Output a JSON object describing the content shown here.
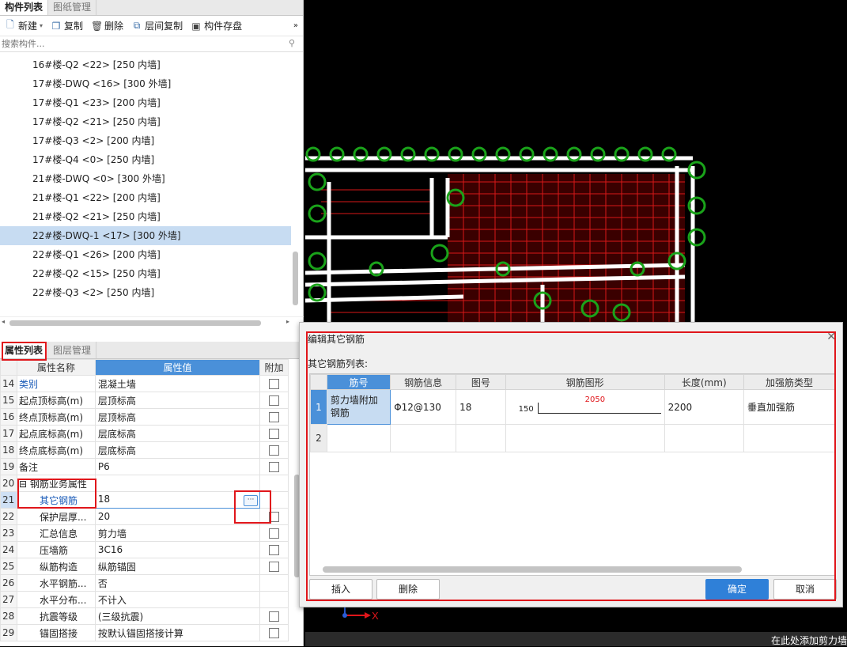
{
  "top_panel": {
    "tabs": [
      "构件列表",
      "图纸管理"
    ],
    "toolbar": {
      "new": "新建",
      "copy": "复制",
      "delete": "删除",
      "floor_copy": "层间复制",
      "save": "构件存盘",
      "more": "»"
    },
    "search_placeholder": "搜索构件...",
    "items": [
      "16#楼-Q2 <22> [250 内墙]",
      "17#楼-DWQ <16> [300 外墙]",
      "17#楼-Q1 <23> [200 内墙]",
      "17#楼-Q2 <21> [250 内墙]",
      "17#楼-Q3 <2> [200 内墙]",
      "17#楼-Q4 <0> [250 内墙]",
      "21#楼-DWQ <0> [300 外墙]",
      "21#楼-Q1 <22> [200 内墙]",
      "21#楼-Q2 <21> [250 内墙]",
      "22#楼-DWQ-1 <17> [300 外墙]",
      "22#楼-Q1 <26> [200 内墙]",
      "22#楼-Q2 <15> [250 内墙]",
      "22#楼-Q3 <2> [250 内墙]"
    ],
    "selected_index": 9
  },
  "prop_panel": {
    "tabs": [
      "属性列表",
      "图层管理"
    ],
    "headers": [
      "属性名称",
      "属性值",
      "附加"
    ],
    "rows": [
      {
        "num": "14",
        "name": "类别",
        "value": "混凝土墙",
        "check": true,
        "blue": true
      },
      {
        "num": "15",
        "name": "起点顶标高(m)",
        "value": "层顶标高",
        "check": true
      },
      {
        "num": "16",
        "name": "终点顶标高(m)",
        "value": "层顶标高",
        "check": true
      },
      {
        "num": "17",
        "name": "起点底标高(m)",
        "value": "层底标高",
        "check": true
      },
      {
        "num": "18",
        "name": "终点底标高(m)",
        "value": "层底标高",
        "check": true
      },
      {
        "num": "19",
        "name": "备注",
        "value": "P6",
        "check": true
      },
      {
        "num": "20",
        "name": "⊟ 钢筋业务属性",
        "value": "",
        "check": false
      },
      {
        "num": "21",
        "name": "其它钢筋",
        "value": "18",
        "check": false,
        "blue": true,
        "selected": true
      },
      {
        "num": "22",
        "name": "保护层厚...",
        "value": "20",
        "check": true
      },
      {
        "num": "23",
        "name": "汇总信息",
        "value": "剪力墙",
        "check": true
      },
      {
        "num": "24",
        "name": "压墙筋",
        "value": "3C16",
        "check": true
      },
      {
        "num": "25",
        "name": "纵筋构造",
        "value": "纵筋锚固",
        "check": true
      },
      {
        "num": "26",
        "name": "水平钢筋...",
        "value": "否",
        "check": false
      },
      {
        "num": "27",
        "name": "水平分布...",
        "value": "不计入",
        "check": false
      },
      {
        "num": "28",
        "name": "抗震等级",
        "value": "(三级抗震)",
        "check": true
      },
      {
        "num": "29",
        "name": "锚固搭接",
        "value": "按默认锚固搭接计算",
        "check": true
      }
    ]
  },
  "dialog": {
    "title": "编辑其它钢筋",
    "subtitle": "其它钢筋列表:",
    "headers": [
      "筋号",
      "钢筋信息",
      "图号",
      "钢筋图形",
      "长度(mm)",
      "加强筋类型"
    ],
    "row1": {
      "num": "1",
      "bar_no": "剪力墙附加钢筋",
      "bar_info": "Φ12@130",
      "fig_no": "18",
      "shape_left": "150",
      "shape_len": "2050",
      "length": "2200",
      "type": "垂直加强筋"
    },
    "row2_num": "2",
    "buttons": {
      "insert": "插入",
      "delete": "删除",
      "ok": "确定",
      "cancel": "取消"
    }
  },
  "status": {
    "hint": "在此处添加剪力墙"
  },
  "colors": {
    "accent": "#4a90d9",
    "highlight_red": "#e0161b",
    "cad_bg": "#000000"
  }
}
